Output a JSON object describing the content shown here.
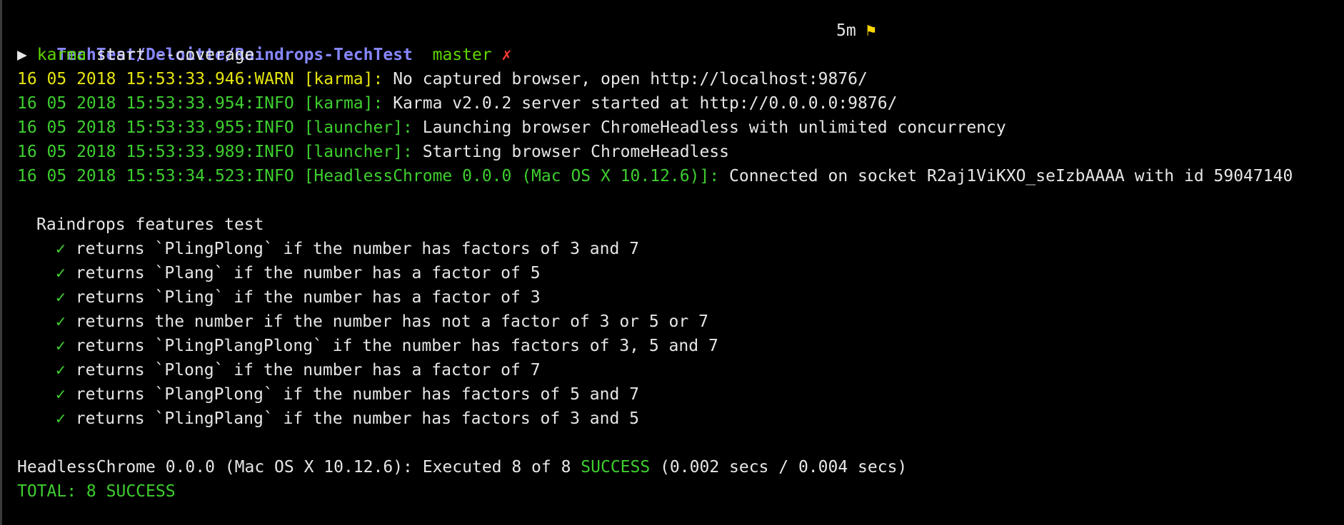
{
  "prompt": {
    "path": "TechTest/Deloitte/Raindrops-TechTest",
    "branch": "master",
    "dirty_mark": "✗",
    "elapsed": "5m",
    "flag_icon": "⚑",
    "arrow": "▶",
    "command": "karma",
    "args": " start --coverage"
  },
  "logs": [
    {
      "prefix": "16 05 2018 15:53:33.946:WARN [karma]:",
      "message": " No captured browser, open http://localhost:9876/"
    },
    {
      "prefix": "16 05 2018 15:53:33.954:INFO [karma]:",
      "message": " Karma v2.0.2 server started at http://0.0.0.0:9876/"
    },
    {
      "prefix": "16 05 2018 15:53:33.955:INFO [launcher]:",
      "message": " Launching browser ChromeHeadless with unlimited concurrency"
    },
    {
      "prefix": "16 05 2018 15:53:33.989:INFO [launcher]:",
      "message": " Starting browser ChromeHeadless"
    },
    {
      "prefix": "16 05 2018 15:53:34.523:INFO [HeadlessChrome 0.0.0 (Mac OS X 10.12.6)]:",
      "message": " Connected on socket R2aj1ViKXO_seIzbAAAA with id 59047140"
    }
  ],
  "suite": {
    "title": "Raindrops features test",
    "check": "✓",
    "tests": [
      "returns `PlingPlong` if the number has factors of 3 and 7",
      "returns `Plang` if the number has a factor of 5",
      "returns `Pling` if the number has a factor of 3",
      "returns the number if the number has not a factor of 3 or 5 or 7",
      "returns `PlingPlangPlong` if the number has factors of 3, 5 and 7",
      "returns `Plong` if the number has a factor of 7",
      "returns `PlangPlong` if the number has factors of 5 and 7",
      "returns `PlingPlang` if the number has factors of 3 and 5"
    ]
  },
  "summary": {
    "executed_prefix": "HeadlessChrome 0.0.0 (Mac OS X 10.12.6): Executed 8 of 8 ",
    "success_word": "SUCCESS",
    "timing": " (0.002 secs / 0.004 secs)",
    "total": "TOTAL: 8 SUCCESS"
  },
  "colors": {
    "background": "#000000",
    "path": "#8787ff",
    "branch": "#5fd700",
    "dirty": "#ff3b30",
    "warn": "#e5e510",
    "info": "#3ecf2f",
    "text": "#e6e6e6"
  }
}
